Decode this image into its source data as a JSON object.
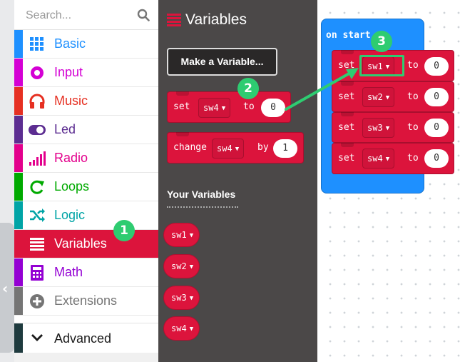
{
  "search": {
    "placeholder": "Search..."
  },
  "categories": [
    {
      "label": "Basic",
      "icon": "grid-icon",
      "color": "#1e90ff"
    },
    {
      "label": "Input",
      "icon": "target-icon",
      "color": "#d400d4"
    },
    {
      "label": "Music",
      "icon": "headphones-icon",
      "color": "#e63022"
    },
    {
      "label": "Led",
      "icon": "toggle-icon",
      "color": "#5c2d91"
    },
    {
      "label": "Radio",
      "icon": "signal-bars-icon",
      "color": "#e3008c"
    },
    {
      "label": "Loops",
      "icon": "loop-arrow-icon",
      "color": "#00aa00"
    },
    {
      "label": "Logic",
      "icon": "shuffle-icon",
      "color": "#00a4a6"
    },
    {
      "label": "Variables",
      "icon": "list-icon",
      "color": "#dc143c",
      "selected": true
    },
    {
      "label": "Math",
      "icon": "calculator-icon",
      "color": "#9400d3"
    },
    {
      "label": "Extensions",
      "icon": "plus-circle-icon",
      "color": "#757575"
    }
  ],
  "advanced": {
    "label": "Advanced",
    "icon": "chevron-down-icon"
  },
  "flyout": {
    "title": "Variables",
    "make_variable": "Make a Variable...",
    "set_block": {
      "keyword": "set",
      "var": "sw4",
      "to": "to",
      "value": "0"
    },
    "change_block": {
      "keyword": "change",
      "var": "sw4",
      "by": "by",
      "value": "1"
    },
    "your_variables_heading": "Your Variables",
    "variables": [
      "sw1",
      "sw2",
      "sw3",
      "sw4"
    ]
  },
  "workspace": {
    "on_start": "on start",
    "statements": [
      {
        "keyword": "set",
        "var": "sw1",
        "to": "to",
        "value": "0"
      },
      {
        "keyword": "set",
        "var": "sw2",
        "to": "to",
        "value": "0"
      },
      {
        "keyword": "set",
        "var": "sw3",
        "to": "to",
        "value": "0"
      },
      {
        "keyword": "set",
        "var": "sw4",
        "to": "to",
        "value": "0"
      }
    ]
  },
  "annotations": {
    "badge1": "1",
    "badge2": "2",
    "badge3": "3",
    "color": "#2ecc71"
  },
  "colors": {
    "variables": "#dc143c",
    "flyout_bg": "#4b4848",
    "on_start": "#1e90ff"
  }
}
